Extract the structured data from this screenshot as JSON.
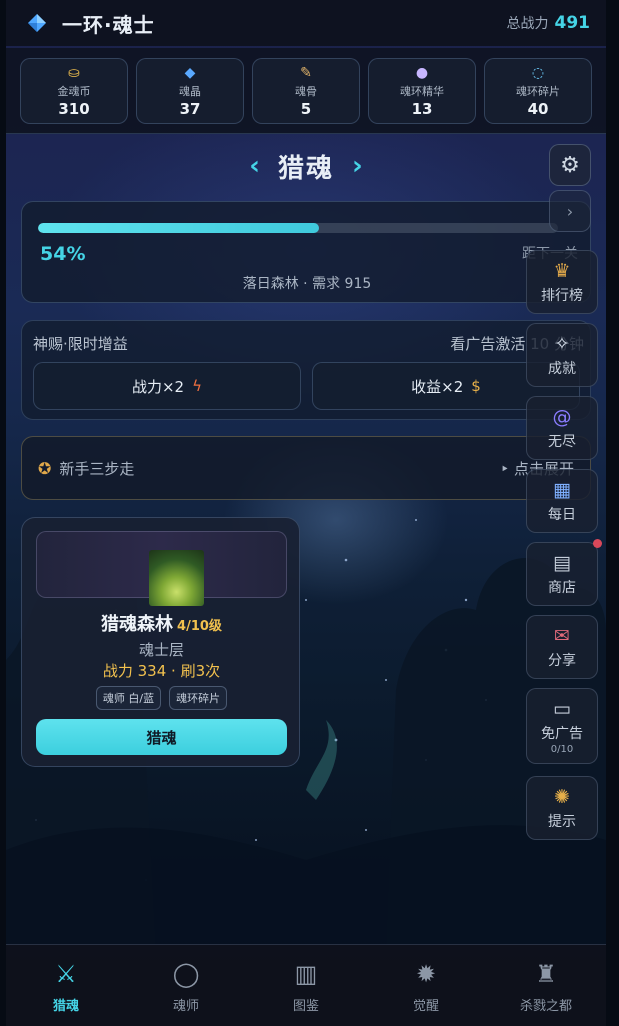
{
  "header": {
    "title": "一环·魂士",
    "power_label": "总战力",
    "power_value": "491"
  },
  "resources": [
    {
      "name": "金魂币",
      "value": "310",
      "icon": "gold-coin-icon"
    },
    {
      "name": "魂晶",
      "value": "37",
      "icon": "soul-crystal-icon"
    },
    {
      "name": "魂骨",
      "value": "5",
      "icon": "soul-bone-icon"
    },
    {
      "name": "魂环精华",
      "value": "13",
      "icon": "essence-drop-icon"
    },
    {
      "name": "魂环碎片",
      "value": "40",
      "icon": "ring-fragment-icon"
    }
  ],
  "hunt": {
    "title": "猎魂",
    "prev_arrow": "‹",
    "next_arrow": "›"
  },
  "progress": {
    "fraction": 0.54,
    "percent_text": "54%",
    "next_text": "距下一关",
    "stage_text": "落日森林 · 需求 915"
  },
  "buff": {
    "title": "神赐·限时增益",
    "hint": "看广告激活 10 分钟",
    "power_label": "战力×2",
    "income_label": "收益×2"
  },
  "guide": {
    "label": "新手三步走",
    "expand": "‣ 点击展开"
  },
  "map": {
    "name": "猎魂森林",
    "level": "4/10级",
    "tier": "魂士层",
    "power": "战力 334 · 刷3次",
    "tags": [
      "魂师 白/蓝",
      "魂环碎片"
    ],
    "button": "猎魂"
  },
  "side_menu": [
    {
      "label": "排行榜",
      "icon": "trophy-icon"
    },
    {
      "label": "成就",
      "icon": "medal-icon"
    },
    {
      "label": "无尽",
      "icon": "spiral-icon"
    },
    {
      "label": "每日",
      "icon": "calendar-icon"
    },
    {
      "label": "商店",
      "icon": "shop-icon"
    },
    {
      "label": "分享",
      "icon": "share-icon"
    },
    {
      "label": "免广告",
      "sub": "0/10",
      "icon": "tv-icon"
    },
    {
      "label": "提示",
      "icon": "lightbulb-icon"
    }
  ],
  "bottom_nav": [
    {
      "label": "猎魂",
      "icon": "crossed-swords-icon",
      "active": true
    },
    {
      "label": "魂师",
      "icon": "ring-icon"
    },
    {
      "label": "图鉴",
      "icon": "book-icon"
    },
    {
      "label": "觉醒",
      "icon": "awaken-icon"
    },
    {
      "label": "杀戮之都",
      "icon": "tower-icon"
    }
  ],
  "colors": {
    "accent": "#45d4e6",
    "gold": "#f2c14e",
    "background": "#1a2a55"
  }
}
